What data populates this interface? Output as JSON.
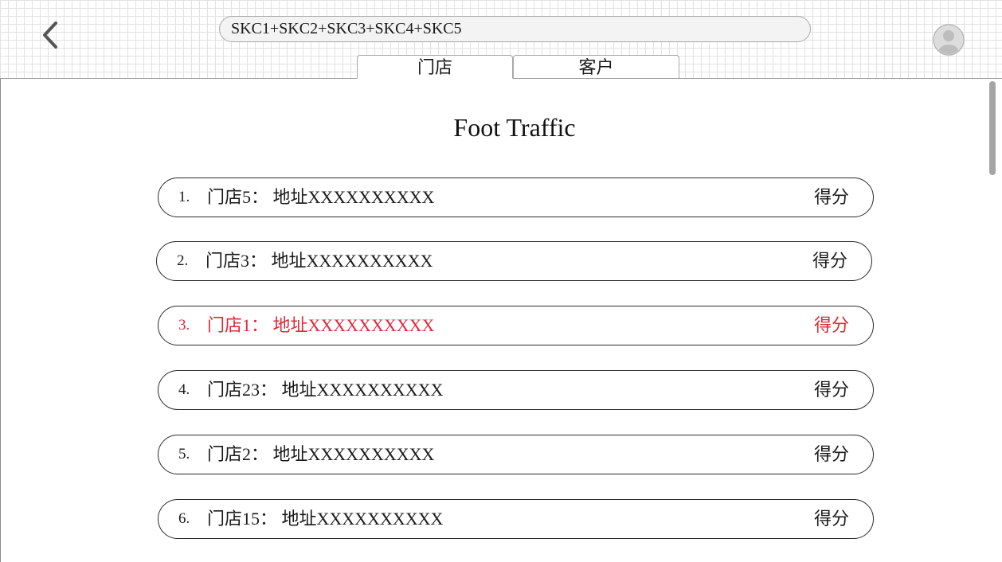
{
  "header": {
    "search": {
      "value": "SKC1+SKC2+SKC3+SKC4+SKC5"
    },
    "tabs": [
      {
        "label": "门店",
        "active": true
      },
      {
        "label": "客户",
        "active": false
      }
    ]
  },
  "icons": {
    "back": "chevron-left-icon",
    "avatar": "user-avatar-icon"
  },
  "colors": {
    "highlight": "#e0283a"
  },
  "main": {
    "title": "Foot Traffic",
    "rows": [
      {
        "rank": "1.",
        "name": "门店5：  地址XXXXXXXXXX",
        "score": "得分"
      },
      {
        "rank": "2.",
        "name": "门店3：  地址XXXXXXXXXX",
        "score": "得分"
      },
      {
        "rank": "3.",
        "name": "门店1：  地址XXXXXXXXXX",
        "score": "得分",
        "highlighted": true
      },
      {
        "rank": "4.",
        "name": "门店23：  地址XXXXXXXXXX",
        "score": "得分"
      },
      {
        "rank": "5.",
        "name": "门店2：  地址XXXXXXXXXX",
        "score": "得分"
      },
      {
        "rank": "6.",
        "name": "门店15：  地址XXXXXXXXXX",
        "score": "得分"
      }
    ]
  }
}
